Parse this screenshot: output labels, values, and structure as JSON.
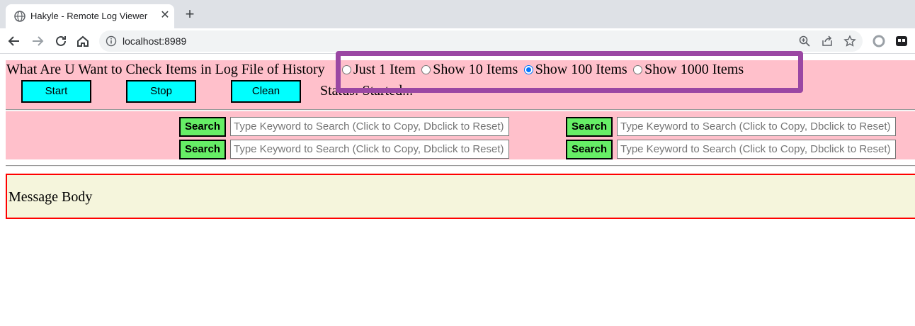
{
  "browser": {
    "tab_title": "Hakyle - Remote Log Viewer",
    "tab_close": "✕",
    "new_tab": "+",
    "url": "localhost:8989"
  },
  "controls": {
    "question": "What Are U Want to Check Items in Log File of History",
    "radio_options": [
      {
        "label": "Just 1 Item",
        "checked": false
      },
      {
        "label": "Show 10 Items",
        "checked": false
      },
      {
        "label": "Show 100 Items",
        "checked": true
      },
      {
        "label": "Show 1000 Items",
        "checked": false
      }
    ],
    "start_label": "Start",
    "stop_label": "Stop",
    "clean_label": "Clean",
    "status_text": "Status: Started..."
  },
  "search": {
    "button_label": "Search",
    "placeholder": "Type Keyword to Search (Click to Copy, Dbclick to Reset)"
  },
  "message": {
    "body_text": "Message Body"
  },
  "colors": {
    "panel_bg": "#ffc0cb",
    "control_button_bg": "#00ffff",
    "search_button_bg": "#66ee66",
    "message_bg": "#f5f5dc",
    "message_border": "#ff0000",
    "highlight_border": "#9a47a3"
  }
}
